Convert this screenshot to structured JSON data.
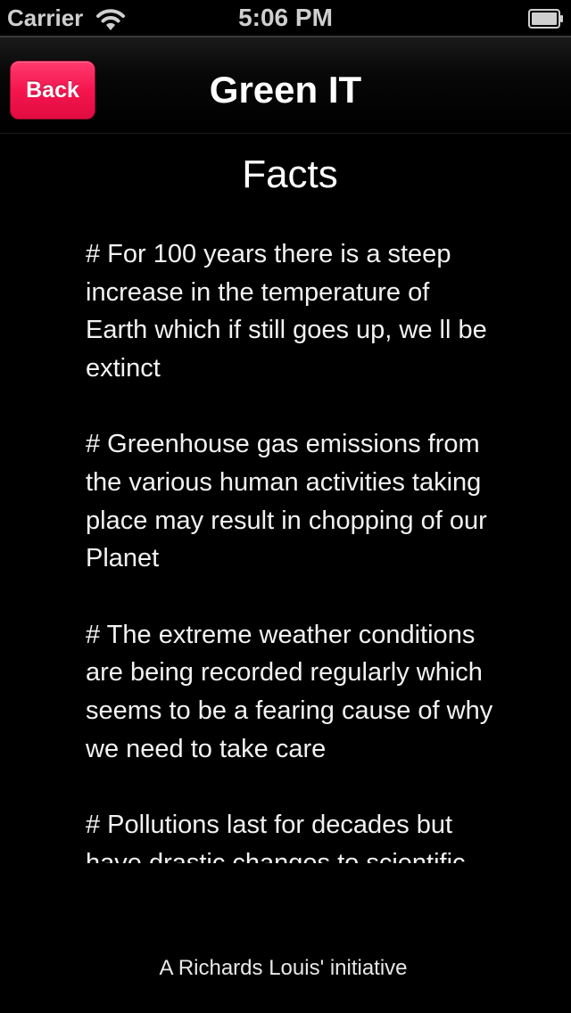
{
  "status_bar": {
    "carrier": "Carrier",
    "time": "5:06 PM",
    "icons": [
      "wifi-icon",
      "battery-icon"
    ]
  },
  "nav_bar": {
    "back_label": "Back",
    "title": "Green IT"
  },
  "content": {
    "heading": "Facts",
    "facts": [
      "# For 100 years there is a steep increase in the temperature of Earth which if still goes up, we ll be extinct",
      "# Greenhouse gas emissions from the various human activities taking place may result in chopping of our Planet",
      "# The extreme weather conditions are being recorded regularly which seems to be a fearing cause of why we need to take care",
      "# Pollutions last for decades but have  drastic changes to scientific"
    ]
  },
  "footer": {
    "text": "A Richards Louis' initiative"
  },
  "colors": {
    "background": "#000000",
    "back_button": "#f5154f",
    "text": "#f2f2f2"
  }
}
